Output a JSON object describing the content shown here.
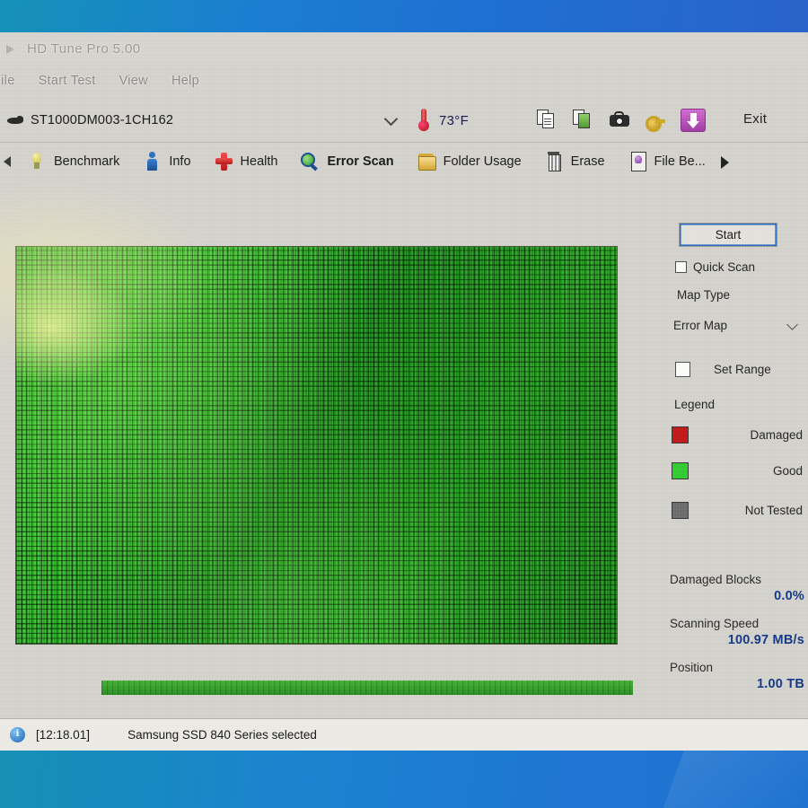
{
  "window": {
    "title": "HD Tune Pro 5.00",
    "icon": "hdd-icon"
  },
  "menu": {
    "items": [
      {
        "label": "File"
      },
      {
        "label": "Start Test"
      },
      {
        "label": "View"
      },
      {
        "label": "Help"
      }
    ]
  },
  "drive_bar": {
    "selected_drive": "ST1000DM003-1CH162",
    "temperature": "73°F",
    "exit_label": "Exit",
    "tools": [
      {
        "name": "copy-icon"
      },
      {
        "name": "copy-green-icon"
      },
      {
        "name": "screenshot-camera-icon"
      },
      {
        "name": "key-icon"
      },
      {
        "name": "download-icon"
      }
    ]
  },
  "tabs": [
    {
      "label": "Benchmark",
      "icon": "lightbulb-icon",
      "active": false
    },
    {
      "label": "Info",
      "icon": "person-icon",
      "active": false
    },
    {
      "label": "Health",
      "icon": "red-cross-icon",
      "active": false
    },
    {
      "label": "Error Scan",
      "icon": "magnifier-icon",
      "active": true
    },
    {
      "label": "Folder Usage",
      "icon": "folder-icon",
      "active": false
    },
    {
      "label": "Erase",
      "icon": "trash-icon",
      "active": false
    },
    {
      "label": "File Be...",
      "icon": "file-benchmark-icon",
      "active": false
    }
  ],
  "panel": {
    "start_label": "Start",
    "quick_scan_label": "Quick Scan",
    "quick_scan_checked": false,
    "map_type_label": "Map Type",
    "map_type_value": "Error Map",
    "set_range_label": "Set Range",
    "set_range_checked": false,
    "legend_title": "Legend",
    "legend": [
      {
        "label": "Damaged",
        "color": "#c21b1b"
      },
      {
        "label": "Good",
        "color": "#33cc33"
      },
      {
        "label": "Not Tested",
        "color": "#6e6e6e"
      }
    ],
    "stats": [
      {
        "label": "Damaged Blocks",
        "value": "0.0%"
      },
      {
        "label": "Scanning Speed",
        "value": "100.97 MB/s"
      },
      {
        "label": "Position",
        "value": "1.00 TB"
      }
    ]
  },
  "error_map": {
    "state": "all-good",
    "good_color": "#2fbb26",
    "progress_percent": 100
  },
  "status_bar": {
    "time": "[12:18.01]",
    "message": "Samsung SSD 840 Series selected"
  }
}
